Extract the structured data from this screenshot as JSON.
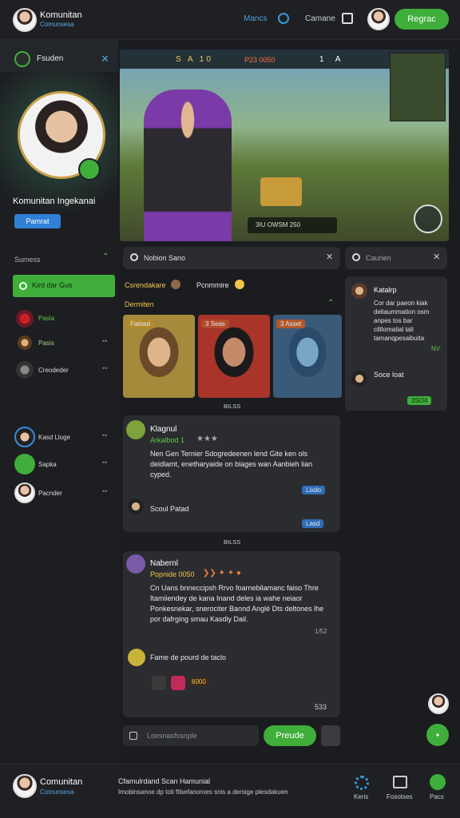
{
  "header": {
    "brand": "Komunitan",
    "brand_sub": "Comunsesa",
    "nav1": "Mancs",
    "nav2": "Camane",
    "cta": "Regrac"
  },
  "sidebar": {
    "section_title": "Fsuden",
    "profile_name": "Komunitan Ingekanai",
    "profile_button": "Pamrat",
    "summary_label": "Sumess",
    "active_item": "Kird dar Gus",
    "items": [
      {
        "label": "Pasla"
      },
      {
        "label": "Pasis"
      },
      {
        "label": "Creodeder"
      },
      {
        "label": "Kasd Lloge"
      },
      {
        "label": "Sapka"
      },
      {
        "label": "Pacnder"
      }
    ]
  },
  "game": {
    "hud_left": "S A 10",
    "hud_mid": "P23 0050",
    "hud_right": "1 A",
    "bottom_bar": "3IU OWSM 250"
  },
  "search": {
    "placeholder": "Nobion Sano",
    "placeholder2": "Caurien"
  },
  "feed": {
    "row_title": "Csrendakare",
    "row_title2": "Pcnmmire",
    "section": "Dermiten",
    "thumbs": [
      {
        "badge": "Fatoad"
      },
      {
        "badge": "3 Seas"
      },
      {
        "badge": "3 Asset"
      }
    ],
    "sep1": "BILSS",
    "post1": {
      "author": "Klagnul",
      "sub": "Arkalbod 1",
      "text": "Nen Gen Ternier Sdogredeenen lend Gite ken ols deidlamt, enetharyaide on biages wan Aanbieh lian cyped.",
      "reply_name": "Scoul Patad",
      "tag1": "Lixdo",
      "tag2": "Lasd"
    },
    "sep2": "BILSS",
    "post2": {
      "author": "Nabernl",
      "sub": "Popnide 0050",
      "text": "Cn Uans bnneccipsh Rrvo foarnebilamanc faiso Thre Itamiiendey de kana Inand deles ia wahe neiaor Ponkesnekar, snerociter Bannd Anglé Dts deltones lhe por dafrging smau Kasdiy Dail.",
      "badge": "1/52",
      "reply": "Fame de pourd de taclo",
      "tag": "6000",
      "count": "533"
    },
    "composer_placeholder": "Loesnasfssnple",
    "composer_button": "Preude"
  },
  "rightpanel": {
    "title": "Katalrp",
    "text": "Cor dar paeon kiak deliaummation osm anpes tos bar ciltlomatial tali tamanqpesaibuita",
    "badge": "NV",
    "sub": "Soce loat",
    "button": "3SO4"
  },
  "footer": {
    "brand": "Comunitan",
    "brand_sub": "Comunsesa",
    "line1": "Cfamulrdand Scan Hamunial",
    "line2": "Imobinsanoe dp toti ftlsefanoroes snis a dersige plesdakuen",
    "nav1": "Keris",
    "nav2": "Fosotses",
    "nav3": "Pacs"
  },
  "colors": {
    "accent": "#3fae3a",
    "link": "#3a9ad9"
  }
}
